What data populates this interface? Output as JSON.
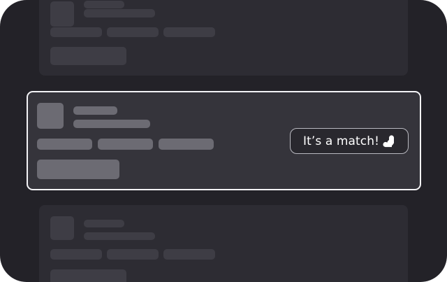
{
  "match_badge": {
    "label": "It’s a match!",
    "icon": "match-logo-icon"
  },
  "colors": {
    "frame_background": "#232228",
    "card_background": "#2d2c33",
    "selected_border": "#f3f3f6",
    "badge_text": "#ffffff"
  }
}
